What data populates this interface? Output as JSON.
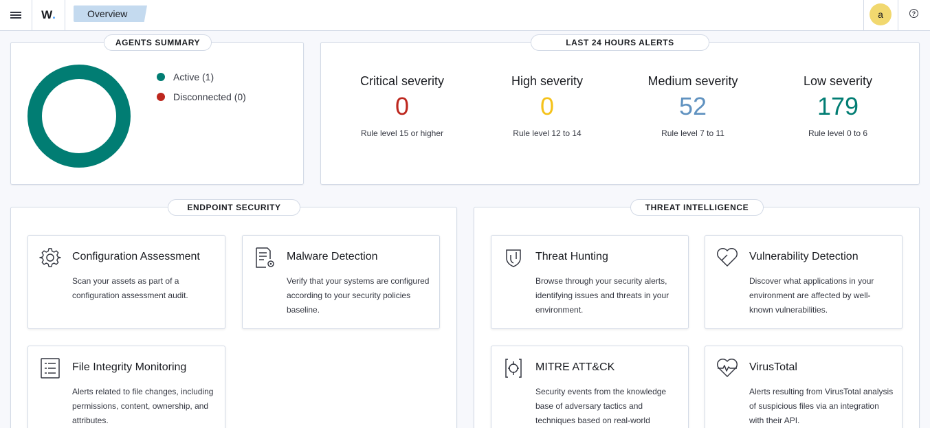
{
  "header": {
    "logo_text": "W",
    "logo_dot": ".",
    "breadcrumb": "Overview",
    "avatar_letter": "a",
    "help_glyph": "?"
  },
  "agents_summary": {
    "title": "AGENTS SUMMARY",
    "legend": [
      {
        "label": "Active (1)",
        "color": "#017d73"
      },
      {
        "label": "Disconnected (0)",
        "color": "#bd271e"
      }
    ]
  },
  "alerts": {
    "title": "LAST 24 HOURS ALERTS",
    "items": [
      {
        "label": "Critical severity",
        "value": "0",
        "rule": "Rule level 15 or higher",
        "color": "#bd271e"
      },
      {
        "label": "High severity",
        "value": "0",
        "rule": "Rule level 12 to 14",
        "color": "#f5c21a"
      },
      {
        "label": "Medium severity",
        "value": "52",
        "rule": "Rule level 7 to 11",
        "color": "#6092c0"
      },
      {
        "label": "Low severity",
        "value": "179",
        "rule": "Rule level 0 to 6",
        "color": "#017d73"
      }
    ]
  },
  "endpoint_security": {
    "title": "ENDPOINT SECURITY",
    "cards": [
      {
        "title": "Configuration Assessment",
        "desc": "Scan your assets as part of a configuration assessment audit.",
        "icon": "gear-icon"
      },
      {
        "title": "Malware Detection",
        "desc": "Verify that your systems are configured according to your security policies baseline.",
        "icon": "document-gear-icon"
      },
      {
        "title": "File Integrity Monitoring",
        "desc": "Alerts related to file changes, including permissions, content, ownership, and attributes.",
        "icon": "list-document-icon"
      }
    ]
  },
  "threat_intelligence": {
    "title": "THREAT INTELLIGENCE",
    "cards": [
      {
        "title": "Threat Hunting",
        "desc": "Browse through your security alerts, identifying issues and threats in your environment.",
        "icon": "shield-icon"
      },
      {
        "title": "Vulnerability Detection",
        "desc": "Discover what applications in your environment are affected by well-known vulnerabilities.",
        "icon": "heart-icon"
      },
      {
        "title": "MITRE ATT&CK",
        "desc": "Security events from the knowledge base of adversary tactics and techniques based on real-world",
        "icon": "crosshair-icon"
      },
      {
        "title": "VirusTotal",
        "desc": "Alerts resulting from VirusTotal analysis of suspicious files via an integration with their API.",
        "icon": "heartbeat-icon"
      }
    ]
  }
}
